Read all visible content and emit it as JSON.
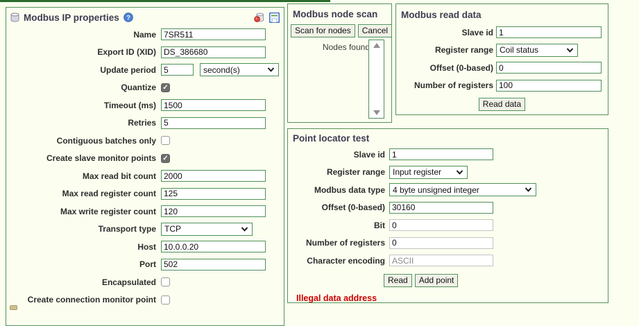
{
  "colors": {
    "panel_border": "#55935c",
    "input_border": "#4f9158",
    "title_text": "#3c3c52",
    "error_text": "#cc0000",
    "page_background": "#fcfeef",
    "checkbox_checked": "#6e6e6e"
  },
  "ip_properties": {
    "title": "Modbus IP properties",
    "rows": [
      {
        "label": "Name",
        "value": "7SR511"
      },
      {
        "label": "Export ID (XID)",
        "value": "DS_386680"
      },
      {
        "label": "Update period",
        "value": "5",
        "unit": "second(s)"
      },
      {
        "label": "Quantize",
        "checked": true
      },
      {
        "label": "Timeout (ms)",
        "value": "1500"
      },
      {
        "label": "Retries",
        "value": "5"
      },
      {
        "label": "Contiguous batches only",
        "checked": false
      },
      {
        "label": "Create slave monitor points",
        "checked": true
      },
      {
        "label": "Max read bit count",
        "value": "2000"
      },
      {
        "label": "Max read register count",
        "value": "125"
      },
      {
        "label": "Max write register count",
        "value": "120"
      },
      {
        "label": "Transport type",
        "value": "TCP"
      },
      {
        "label": "Host",
        "value": "10.0.0.20"
      },
      {
        "label": "Port",
        "value": "502"
      },
      {
        "label": "Encapsulated",
        "checked": false
      },
      {
        "label": "Create connection monitor point",
        "checked": false
      }
    ]
  },
  "node_scan": {
    "title": "Modbus node scan",
    "scan_label": "Scan for nodes",
    "cancel_label": "Cancel",
    "nodes_found_label": "Nodes found"
  },
  "read_data": {
    "title": "Modbus read data",
    "slave_id": {
      "label": "Slave id",
      "value": "1"
    },
    "register_range": {
      "label": "Register range",
      "value": "Coil status"
    },
    "offset": {
      "label": "Offset (0-based)",
      "value": "0"
    },
    "num_registers": {
      "label": "Number of registers",
      "value": "100"
    },
    "read_button": "Read data"
  },
  "point_locator": {
    "title": "Point locator test",
    "slave_id": {
      "label": "Slave id",
      "value": "1"
    },
    "register_range": {
      "label": "Register range",
      "value": "Input register"
    },
    "data_type": {
      "label": "Modbus data type",
      "value": "4 byte unsigned integer"
    },
    "offset": {
      "label": "Offset (0-based)",
      "value": "30160"
    },
    "bit": {
      "label": "Bit",
      "value": "0"
    },
    "num_registers": {
      "label": "Number of registers",
      "value": "0"
    },
    "encoding": {
      "label": "Character encoding",
      "value": "ASCII"
    },
    "read_button": "Read",
    "add_button": "Add point",
    "error": "Illegal data address"
  },
  "icons": {
    "datasource": "database-icon",
    "help": "help-icon",
    "disable": "disable-datasource-icon",
    "save": "save-icon",
    "chevron": "chevron-down-icon",
    "scroll_up": "scroll-up-icon",
    "scroll_down": "scroll-down-icon"
  }
}
